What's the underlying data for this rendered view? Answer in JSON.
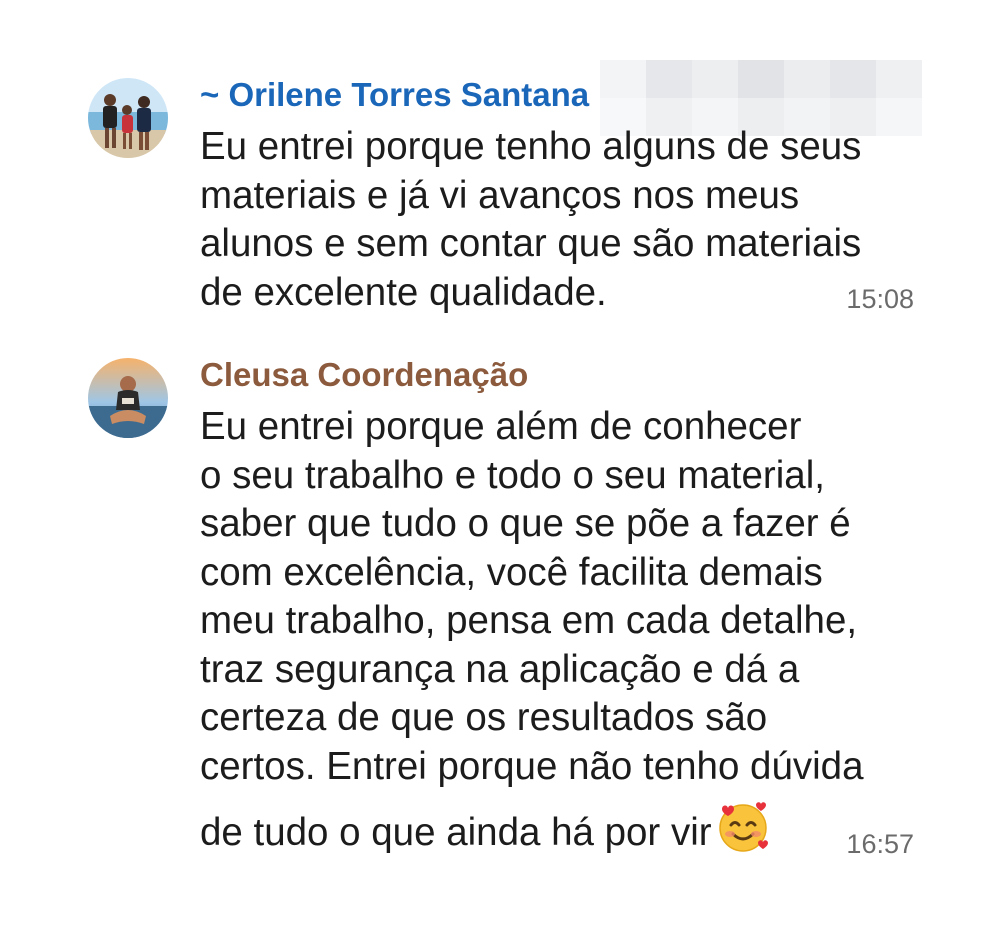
{
  "messages": [
    {
      "sender": "~ Orilene Torres Santana",
      "sender_color": "#1a66b8",
      "lines": [
        "Eu entrei porque tenho alguns de seus",
        "materiais e já vi avanços nos meus",
        "alunos e sem contar que são materiais",
        "de excelente qualidade."
      ],
      "time": "15:08",
      "avatar_icon": "family-photo-avatar"
    },
    {
      "sender": "Cleusa Coordenação",
      "sender_color": "#8c5a3c",
      "lines": [
        "Eu entrei porque além de conhecer",
        "o seu trabalho e todo o seu material,",
        "saber que tudo o que se põe a fazer é",
        "com excelência, você facilita demais",
        "meu trabalho, pensa em cada detalhe,",
        "traz segurança na aplicação e dá a",
        "certeza de que os resultados são",
        "certos. Entrei porque não tenho dúvida",
        "de tudo o que ainda há por vir"
      ],
      "emoji": "smiling-face-with-hearts-icon",
      "time": "16:57",
      "avatar_icon": "beach-person-photo-avatar"
    }
  ]
}
